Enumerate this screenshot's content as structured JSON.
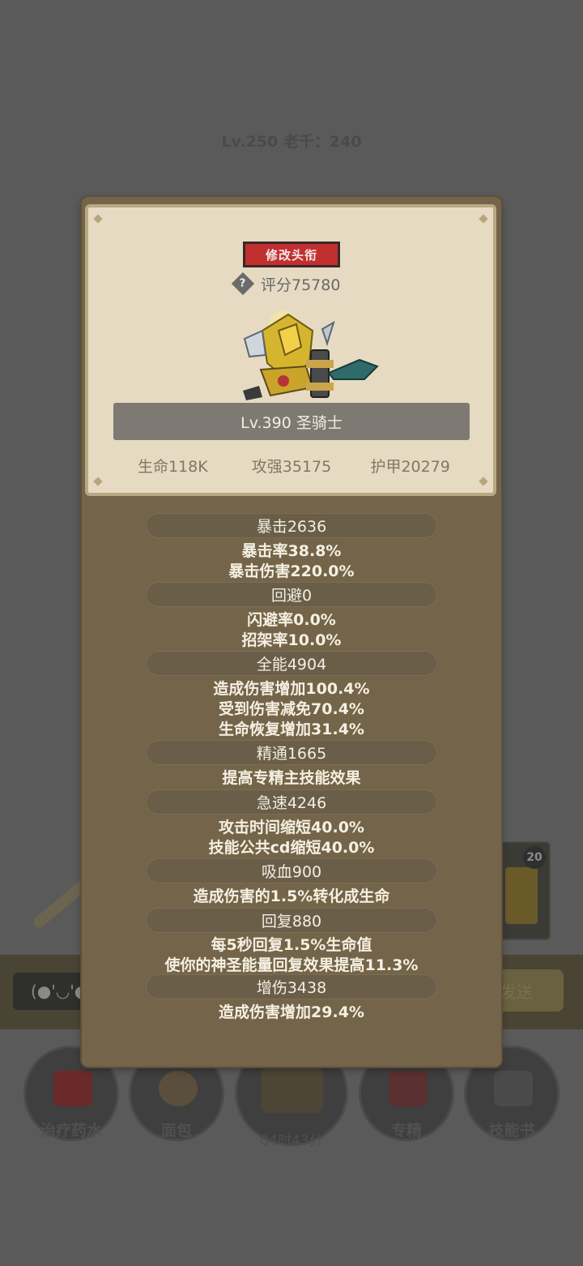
{
  "background": {
    "header": "Lv.250 老千：240",
    "card_badge": "20",
    "chat_placeholder": "(●'◡'●",
    "send_label": "发送",
    "bottom_buttons": [
      {
        "label": "治疗药水"
      },
      {
        "label": "面包"
      },
      {
        "label": "04时43分"
      },
      {
        "label": "专精"
      },
      {
        "label": "技能书"
      }
    ]
  },
  "modal": {
    "rename_button": "修改头衔",
    "score_icon": "?",
    "score": "评分75780",
    "hero_level_class": "Lv.390 圣骑士",
    "base_stats": {
      "life": "生命118K",
      "attack": "攻强35175",
      "armor": "护甲20279"
    },
    "sections": [
      {
        "title": "暴击2636",
        "lines": [
          "暴击率38.8%",
          "暴击伤害220.0%"
        ]
      },
      {
        "title": "回避0",
        "lines": [
          "闪避率0.0%",
          "招架率10.0%"
        ]
      },
      {
        "title": "全能4904",
        "lines": [
          "造成伤害增加100.4%",
          "受到伤害减免70.4%",
          "生命恢复增加31.4%"
        ]
      },
      {
        "title": "精通1665",
        "lines": [
          "提高专精主技能效果"
        ]
      },
      {
        "title": "急速4246",
        "lines": [
          "攻击时间缩短40.0%",
          "技能公共cd缩短40.0%"
        ]
      },
      {
        "title": "吸血900",
        "lines": [
          "造成伤害的1.5%转化成生命"
        ]
      },
      {
        "title": "回复880",
        "lines": [
          "每5秒回复1.5%生命值",
          "使你的神圣能量回复效果提高11.3%"
        ]
      },
      {
        "title": "增伤3438",
        "lines": [
          "造成伤害增加29.4%"
        ]
      }
    ]
  }
}
